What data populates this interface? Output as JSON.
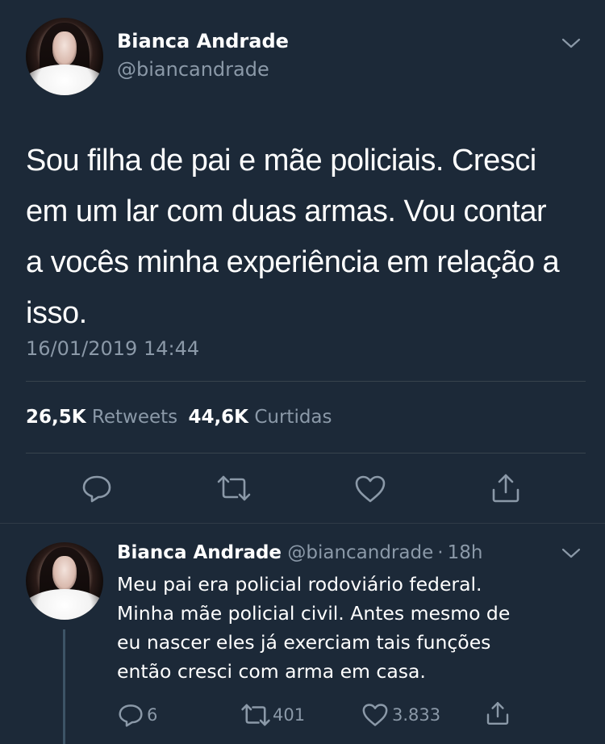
{
  "main_tweet": {
    "author_name": "Bianca Andrade",
    "author_handle": "@biancandrade",
    "text_lines": [
      "Sou filha de pai e mãe policiais. Cresci",
      "em um lar com duas armas. Vou contar",
      "a vocês minha experiência em relação a",
      "isso."
    ],
    "timestamp": "16/01/2019 14:44",
    "retweets_count": "26,5K",
    "retweets_label": "Retweets",
    "likes_count": "44,6K",
    "likes_label": "Curtidas"
  },
  "reply_tweet": {
    "author_name": "Bianca Andrade",
    "author_handle": "@biancandrade",
    "separator": "·",
    "time": "18h",
    "text_lines": [
      "Meu pai era policial rodoviário federal.",
      "Minha mãe policial civil. Antes mesmo de",
      "eu nascer eles já exerciam tais funções",
      "então cresci com arma em casa."
    ],
    "replies_count": "6",
    "retweets_count": "401",
    "likes_count": "3.833"
  },
  "colors": {
    "background": "#1c2938",
    "muted_text": "#8b99a8",
    "divider": "#38444d"
  },
  "icons": [
    "chevron-down-icon",
    "reply-icon",
    "retweet-icon",
    "like-icon",
    "share-icon"
  ]
}
